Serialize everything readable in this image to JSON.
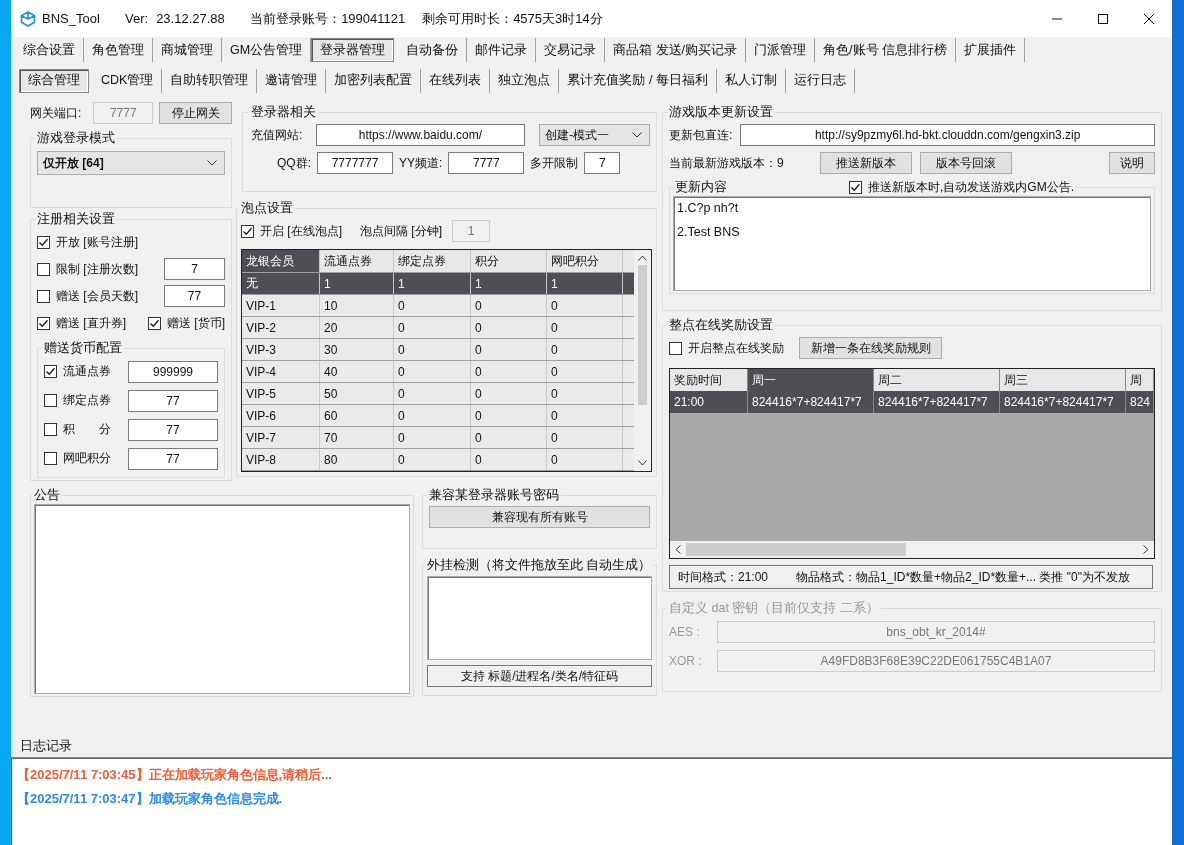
{
  "window": {
    "title": "BNS_Tool",
    "version_label": "Ver:",
    "version": "23.12.27.88",
    "account": "当前登录账号：199041121",
    "remaining": "剩余可用时长：4575天3时14分"
  },
  "main_tabs": [
    {
      "label": "综合设置",
      "selected": false
    },
    {
      "label": "角色管理",
      "selected": false
    },
    {
      "label": "商城管理",
      "selected": false
    },
    {
      "label": "GM公告管理",
      "selected": false
    },
    {
      "label": "登录器管理",
      "selected": true
    },
    {
      "label": "自动备份",
      "selected": false
    },
    {
      "label": "邮件记录",
      "selected": false
    },
    {
      "label": "交易记录",
      "selected": false
    },
    {
      "label": "商品箱 发送/购买记录",
      "selected": false
    },
    {
      "label": "门派管理",
      "selected": false
    },
    {
      "label": "角色/账号 信息排行榜",
      "selected": false
    },
    {
      "label": "扩展插件",
      "selected": false
    }
  ],
  "sub_tabs": [
    {
      "label": "综合管理",
      "selected": true
    },
    {
      "label": "CDK管理",
      "selected": false
    },
    {
      "label": "自助转职管理",
      "selected": false
    },
    {
      "label": "邀请管理",
      "selected": false
    },
    {
      "label": "加密列表配置",
      "selected": false
    },
    {
      "label": "在线列表",
      "selected": false
    },
    {
      "label": "独立泡点",
      "selected": false
    },
    {
      "label": "累计充值奖励 / 每日福利",
      "selected": false
    },
    {
      "label": "私人订制",
      "selected": false
    },
    {
      "label": "运行日志",
      "selected": false
    }
  ],
  "gateway": {
    "port_label": "网关端口:",
    "port": "7777",
    "port_disabled": true,
    "stop_button": "停止网关"
  },
  "login_mode": {
    "title": "游戏登录模式",
    "value": "仅开放 [64]"
  },
  "registration": {
    "title": "注册相关设置",
    "options": [
      {
        "label": "开放 [账号注册]",
        "checked": true
      },
      {
        "label": "限制 [注册次数]",
        "checked": false,
        "value": "7"
      },
      {
        "label": "赠送 [会员天数]",
        "checked": false,
        "value": "77"
      },
      {
        "label": "赠送 [直升券]",
        "checked": true
      },
      {
        "label": "赠送 [货币]",
        "checked": true
      }
    ],
    "currency": {
      "title": "赠送货币配置",
      "items": [
        {
          "label": "流通点券",
          "checked": true,
          "value": "999999"
        },
        {
          "label": "绑定点券",
          "checked": false,
          "value": "77"
        },
        {
          "label": "积　　分",
          "checked": false,
          "value": "77"
        },
        {
          "label": "网吧积分",
          "checked": false,
          "value": "77"
        }
      ]
    }
  },
  "launcher": {
    "title": "登录器相关",
    "recharge_label": "充值网站:",
    "recharge_url": "https://www.baidu.com/",
    "create_mode": "创建-模式一",
    "qq_label": "QQ群:",
    "qq": "7777777",
    "yy_label": "YY频道:",
    "yy": "7777",
    "multi_label": "多开限制",
    "multi": "7"
  },
  "bubble": {
    "title": "泡点设置",
    "enabled": {
      "label": "开启 [在线泡点]",
      "checked": true
    },
    "interval_label": "泡点间隔 [分钟]",
    "interval": "1",
    "interval_disabled": true,
    "columns": [
      {
        "label": "龙银会员",
        "selected": true
      },
      {
        "label": "流通点券",
        "selected": false
      },
      {
        "label": "绑定点券",
        "selected": false
      },
      {
        "label": "积分",
        "selected": false
      },
      {
        "label": "网吧积分",
        "selected": false
      }
    ],
    "rows": [
      {
        "cells": [
          "无",
          "1",
          "1",
          "1",
          "1"
        ],
        "selected": true
      },
      {
        "cells": [
          "VIP-1",
          "10",
          "0",
          "0",
          "0"
        ],
        "selected": false
      },
      {
        "cells": [
          "VIP-2",
          "20",
          "0",
          "0",
          "0"
        ],
        "selected": false
      },
      {
        "cells": [
          "VIP-3",
          "30",
          "0",
          "0",
          "0"
        ],
        "selected": false
      },
      {
        "cells": [
          "VIP-4",
          "40",
          "0",
          "0",
          "0"
        ],
        "selected": false
      },
      {
        "cells": [
          "VIP-5",
          "50",
          "0",
          "0",
          "0"
        ],
        "selected": false
      },
      {
        "cells": [
          "VIP-6",
          "60",
          "0",
          "0",
          "0"
        ],
        "selected": false
      },
      {
        "cells": [
          "VIP-7",
          "70",
          "0",
          "0",
          "0"
        ],
        "selected": false
      },
      {
        "cells": [
          "VIP-8",
          "80",
          "0",
          "0",
          "0"
        ],
        "selected": false
      }
    ]
  },
  "version_update": {
    "title": "游戏版本更新设置",
    "link_label": "更新包直连:",
    "link": "http://sy9pzmy6l.hd-bkt.clouddn.com/gengxin3.zip",
    "current_version": "当前最新游戏版本：9",
    "push_button": "推送新版本",
    "rollback_button": "版本号回滚",
    "help_button": "说明",
    "content_title": "更新内容",
    "auto_notice": {
      "label": "推送新版本时,自动发送游戏内GM公告.",
      "checked": true
    },
    "content_lines": [
      "1.C?p nh?t",
      "2.Test BNS"
    ]
  },
  "online_reward": {
    "title": "整点在线奖励设置",
    "enabled": {
      "label": "开启整点在线奖励",
      "checked": false
    },
    "add_button": "新增一条在线奖励规则",
    "columns": [
      {
        "label": "奖励时间",
        "selected": false
      },
      {
        "label": "周一",
        "selected": true
      },
      {
        "label": "周二",
        "selected": false
      },
      {
        "label": "周三",
        "selected": false
      },
      {
        "label": "周",
        "selected": false
      }
    ],
    "rows": [
      {
        "cells": [
          "21:00",
          "824416*7+824417*7",
          "824416*7+824417*7",
          "824416*7+824417*7",
          "824"
        ],
        "selected": true
      }
    ],
    "time_hint": "时间格式：21:00",
    "item_hint": "物品格式：物品1_ID*数量+物品2_ID*数量+... 类推  \"0\"为不发放"
  },
  "dat_key": {
    "title": "自定义 dat 密钥（目前仅支持 二系）",
    "disabled": true,
    "aes_label": "AES :",
    "aes": "bns_obt_kr_2014#",
    "xor_label": "XOR :",
    "xor": "A49FD8B3F68E39C22DE061755C4B1A07"
  },
  "notice": {
    "title": "公告"
  },
  "compat": {
    "title": "兼容某登录器账号密码",
    "button": "兼容现有所有账号"
  },
  "cheat_detect": {
    "title": "外挂检测（将文件拖放至此 自动生成）",
    "button": "支持  标题/进程名/类名/特征码"
  },
  "log": {
    "title": "日志记录",
    "entries": [
      {
        "text": "【2025/7/11 7:03:45】正在加载玩家角色信息,请稍后...",
        "color": "#f0603a"
      },
      {
        "text": "【2025/7/11 7:03:47】加载玩家角色信息完成.",
        "color": "#2b8be6"
      }
    ]
  }
}
